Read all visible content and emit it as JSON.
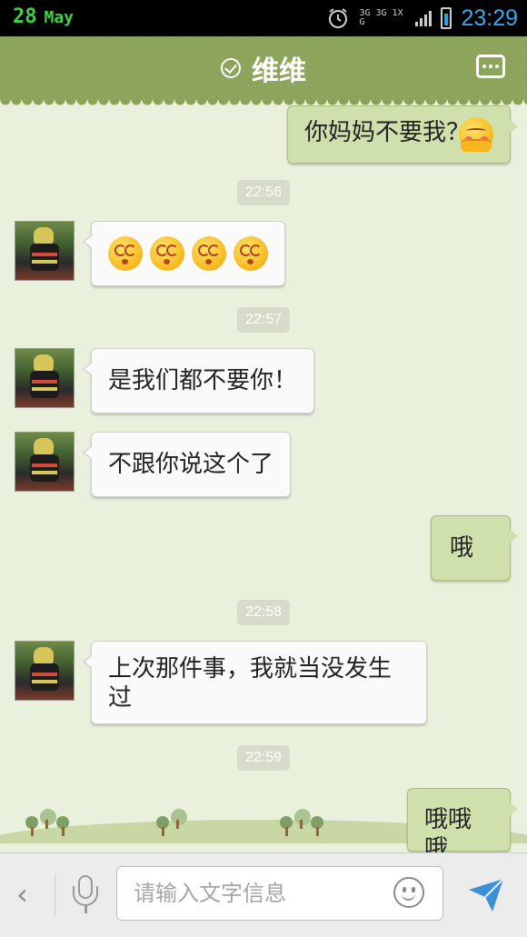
{
  "status_bar": {
    "day": "28",
    "month": "May",
    "network": "3G 3G 1X G",
    "time": "23:29",
    "icons": [
      "alarm-icon",
      "network-icon",
      "signal-icon",
      "battery-icon"
    ]
  },
  "header": {
    "title": "维维",
    "icons": [
      "check-circle-icon",
      "more-menu-icon"
    ]
  },
  "messages": [
    {
      "direction": "out",
      "text": "你妈妈不要我？",
      "emoji": "shy-emoji"
    },
    {
      "timestamp": "22:56"
    },
    {
      "direction": "in",
      "emoji": "dizzy-emoji",
      "emoji_count": 4
    },
    {
      "timestamp": "22:57"
    },
    {
      "direction": "in",
      "text": "是我们都不要你！"
    },
    {
      "direction": "in",
      "text": "不跟你说这个了"
    },
    {
      "direction": "out",
      "text": "哦"
    },
    {
      "timestamp": "22:58"
    },
    {
      "direction": "in",
      "text": "上次那件事，我就当没发生过"
    },
    {
      "timestamp": "22:59"
    },
    {
      "direction": "out",
      "text": "哦哦哦"
    }
  ],
  "input_bar": {
    "back_icon": "chevron-left-icon",
    "voice_icon": "microphone-icon",
    "placeholder": "请输入文字信息",
    "emoji_icon": "smiley-icon",
    "send_icon": "send-icon"
  },
  "colors": {
    "header_bg": "#8aa257",
    "chat_bg": "#e9f0dc",
    "outgoing_bubble": "#cfe0ac",
    "incoming_bubble": "#fafafa",
    "clock": "#3aa7e8",
    "date": "#3fd14a"
  }
}
